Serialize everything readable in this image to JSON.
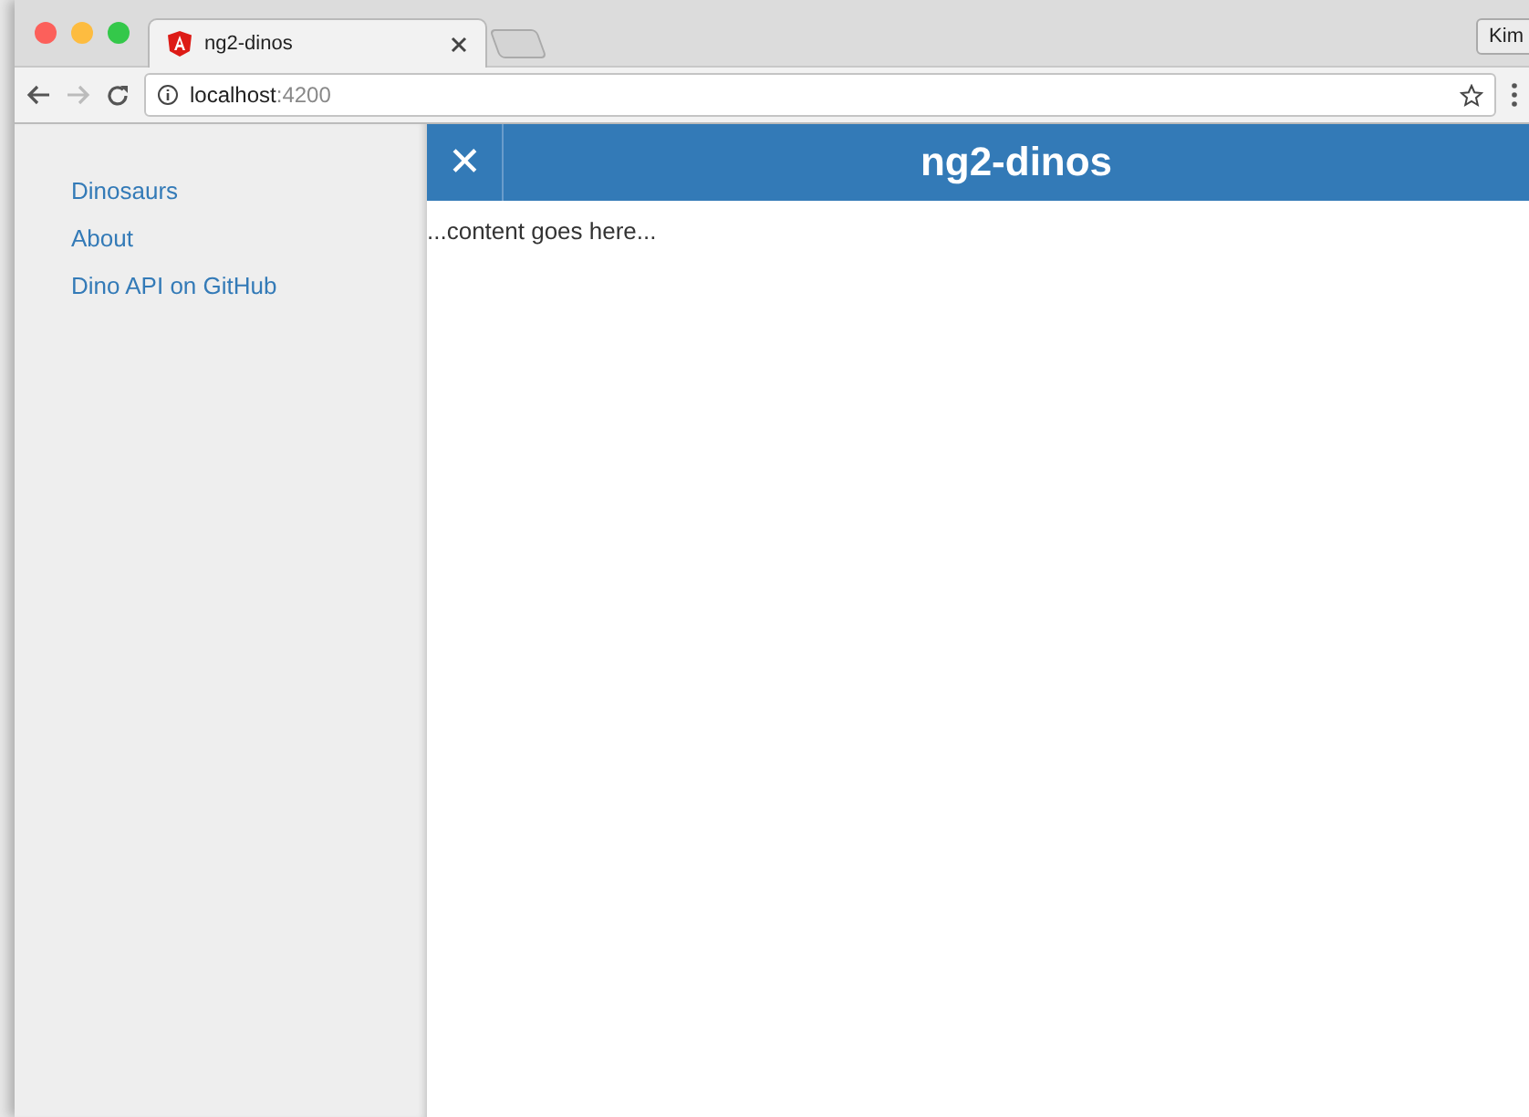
{
  "browser": {
    "tab": {
      "title": "ng2-dinos",
      "selected": true
    },
    "profile": "Kim",
    "address": {
      "host": "localhost",
      "port": ":4200"
    }
  },
  "sidebar": {
    "items": [
      {
        "label": "Dinosaurs"
      },
      {
        "label": "About"
      },
      {
        "label": "Dino API on GitHub"
      }
    ]
  },
  "header": {
    "close": "✕",
    "title": "ng2-dinos"
  },
  "content": "...content goes here..."
}
